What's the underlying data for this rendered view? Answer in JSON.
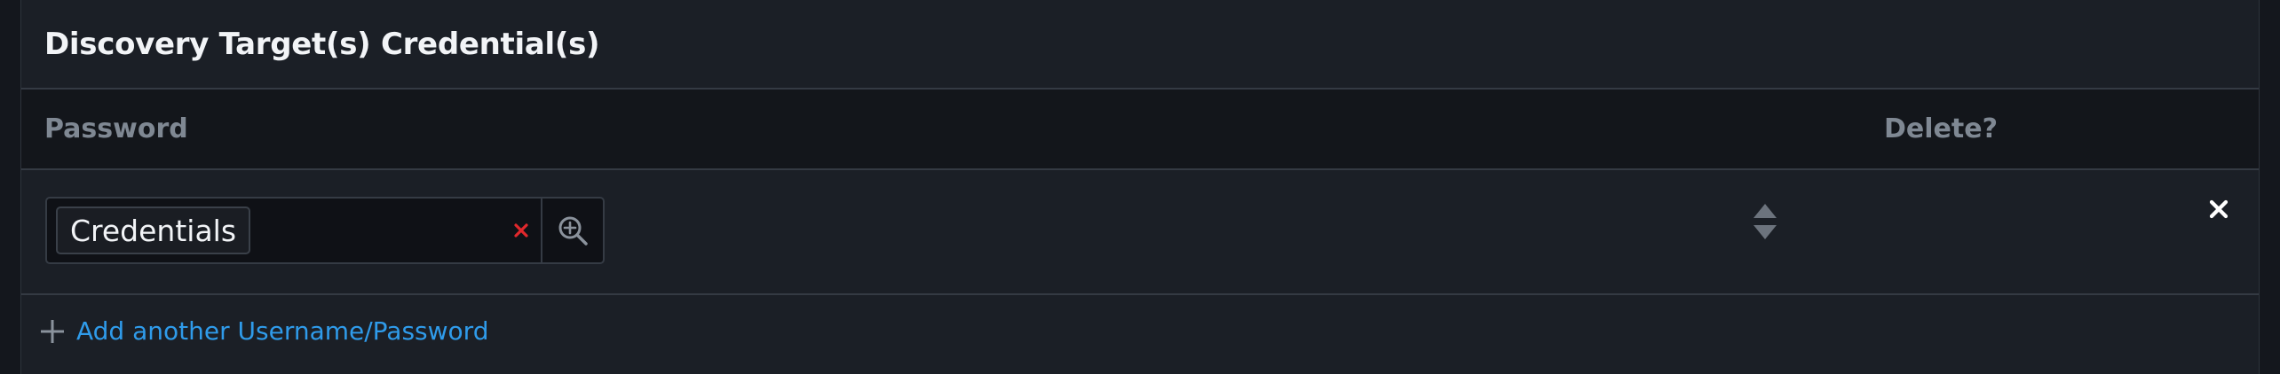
{
  "section": {
    "title": "Discovery Target(s) Credential(s)"
  },
  "table": {
    "columns": {
      "password": "Password",
      "delete": "Delete?"
    },
    "rows": [
      {
        "credential_tag": "Credentials"
      }
    ]
  },
  "actions": {
    "add_label": "Add another Username/Password"
  },
  "colors": {
    "accent_link": "#2f9bea",
    "clear_icon": "#e0282c",
    "background": "#1b1f26",
    "header_background": "#13161b"
  },
  "icons": {
    "clear": "close-icon",
    "lookup": "zoom-in-icon",
    "reorder": "sort-icon",
    "delete": "close-icon",
    "add": "plus-icon"
  }
}
